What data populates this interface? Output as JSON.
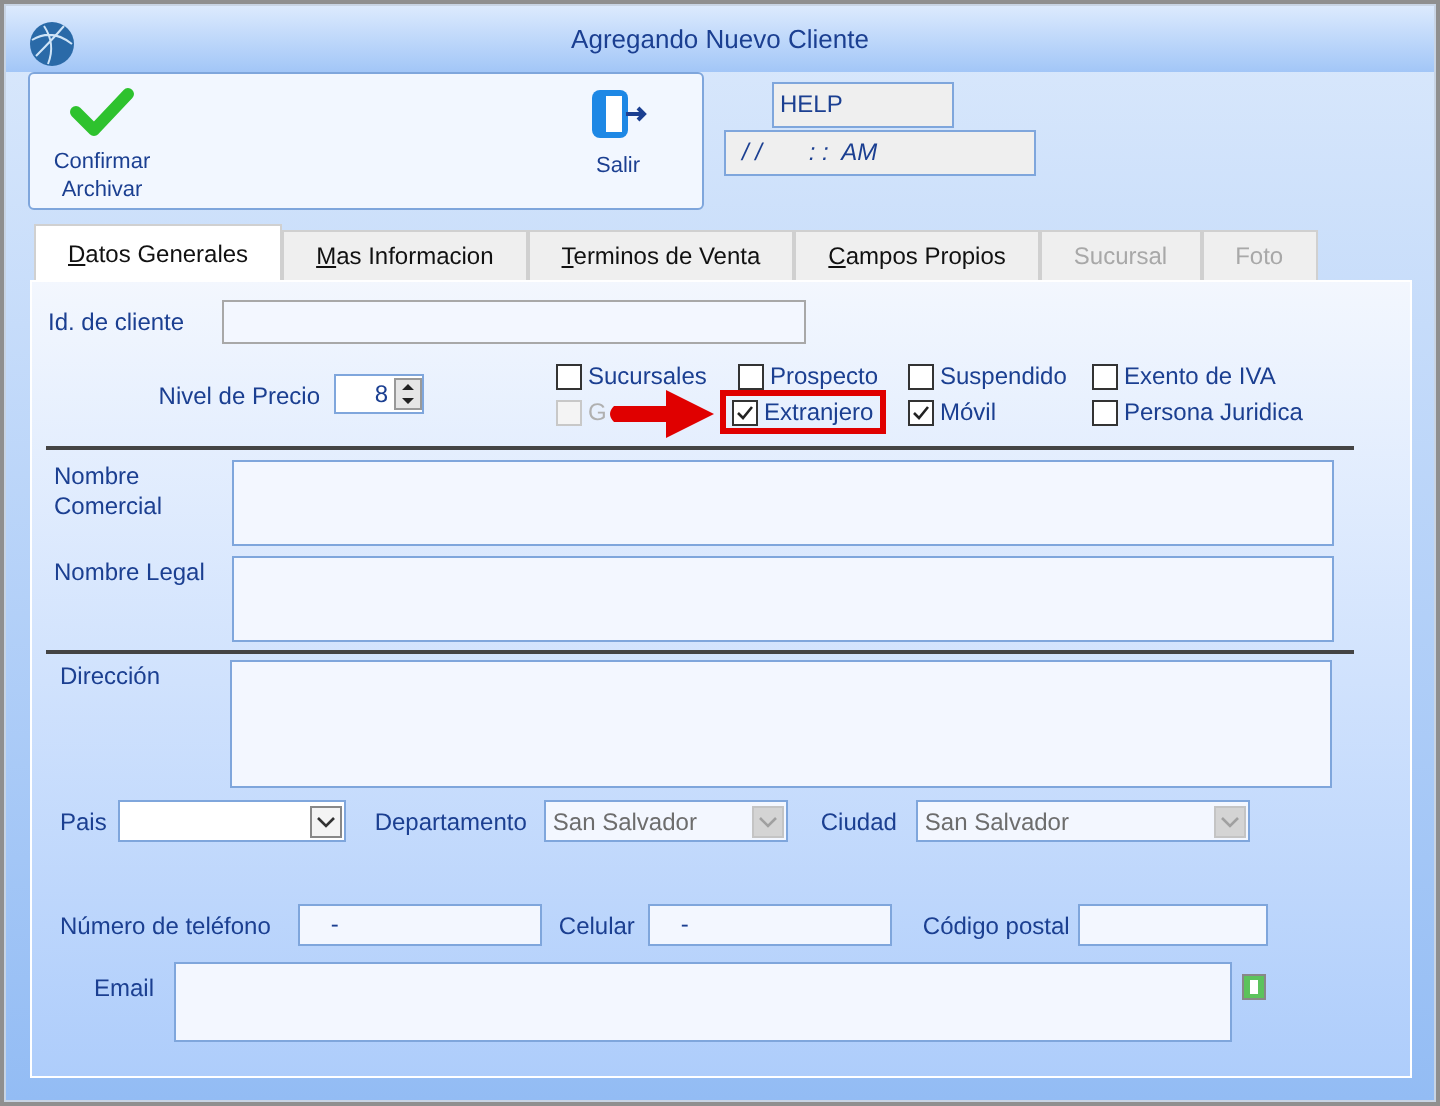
{
  "window": {
    "title": "Agregando Nuevo Cliente"
  },
  "toolbar": {
    "buttons": [
      {
        "label": "Confirmar Archivar",
        "kind": "confirm"
      },
      {
        "label": "Salir",
        "kind": "exit"
      }
    ]
  },
  "help_field": {
    "value": "HELP"
  },
  "datetime_field": {
    "value": "/ /       : :  AM"
  },
  "tabs": [
    {
      "label": "Datos Generales",
      "selected": true,
      "disabled": false
    },
    {
      "label": "Mas Informacion",
      "selected": false,
      "disabled": false
    },
    {
      "label": "Terminos de Venta",
      "selected": false,
      "disabled": false
    },
    {
      "label": "Campos Propios",
      "selected": false,
      "disabled": false
    },
    {
      "label": "Sucursal",
      "selected": false,
      "disabled": true
    },
    {
      "label": "Foto",
      "selected": false,
      "disabled": true
    }
  ],
  "client_id": {
    "label": "Id. de cliente"
  },
  "price_level": {
    "label": "Nivel de Precio",
    "value": "8"
  },
  "checkboxes": [
    {
      "label": "Sucursales",
      "checked": false,
      "disabled": false,
      "highlighted": false
    },
    {
      "label": "Prospecto",
      "checked": false,
      "disabled": false,
      "highlighted": false
    },
    {
      "label": "Suspendido",
      "checked": false,
      "disabled": false,
      "highlighted": false
    },
    {
      "label": "Exento de IVA",
      "checked": false,
      "disabled": false,
      "highlighted": false
    },
    {
      "label": "G",
      "checked": false,
      "disabled": true,
      "highlighted": false
    },
    {
      "label": "Extranjero",
      "checked": true,
      "disabled": false,
      "highlighted": true
    },
    {
      "label": "Móvil",
      "checked": true,
      "disabled": false,
      "highlighted": false
    },
    {
      "label": "Persona Juridica",
      "checked": false,
      "disabled": false,
      "highlighted": false
    }
  ],
  "annotation": {
    "kind": "arrow"
  },
  "trade_name": {
    "label": "Nombre Comercial"
  },
  "legal_name": {
    "label": "Nombre Legal"
  },
  "address": {
    "label": "Dirección"
  },
  "location": [
    {
      "label": "Pais",
      "disabled": false
    },
    {
      "label": "Departamento",
      "value": "San Salvador",
      "disabled": true
    },
    {
      "label": "Ciudad",
      "value": "San Salvador",
      "disabled": true
    }
  ],
  "phones": [
    {
      "label": "Número de teléfono",
      "value": "-"
    },
    {
      "label": "Celular",
      "value": "-"
    },
    {
      "label": "Código postal"
    }
  ],
  "email": {
    "label": "Email"
  }
}
